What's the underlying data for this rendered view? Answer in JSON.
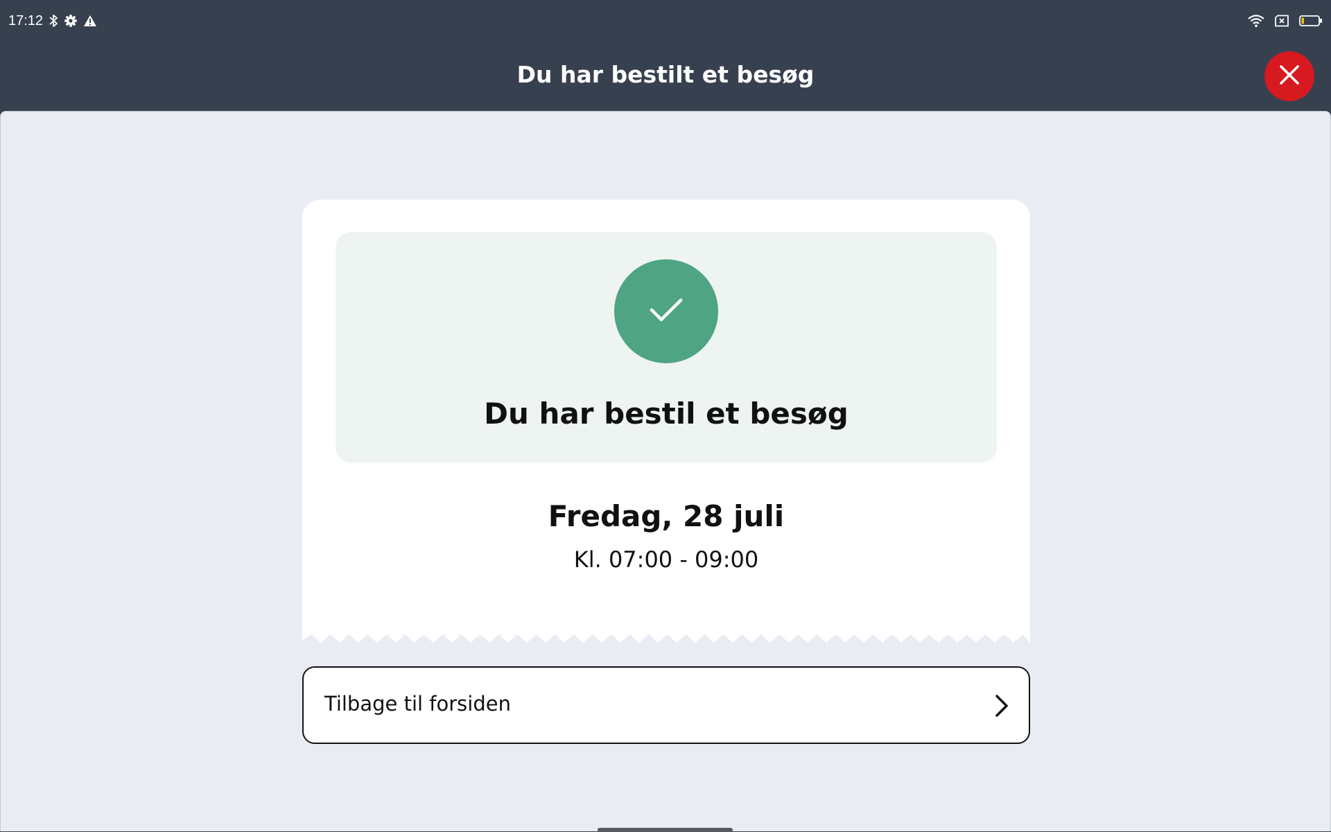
{
  "status_bar": {
    "time": "17:12",
    "icons_left": [
      "bluetooth-icon",
      "settings-gear-icon",
      "warning-icon"
    ],
    "icons_right": [
      "wifi-icon",
      "sim-card-icon",
      "battery-icon"
    ],
    "battery_level": 0.15
  },
  "header": {
    "title": "Du har bestilt et besøg",
    "close_icon": "close-icon"
  },
  "confirmation": {
    "icon": "check-icon",
    "title": "Du har bestil et besøg",
    "date": "Fredag, 28 juli",
    "time": "Kl. 07:00 - 09:00"
  },
  "actions": {
    "back_label": "Tilbage til forsiden",
    "back_icon": "chevron-right-icon"
  },
  "colors": {
    "header_bg": "#37404f",
    "close_button": "#d71920",
    "success_green": "#4fa484",
    "success_panel_bg": "#eef4f2",
    "page_bg": "#e9ecf3"
  }
}
